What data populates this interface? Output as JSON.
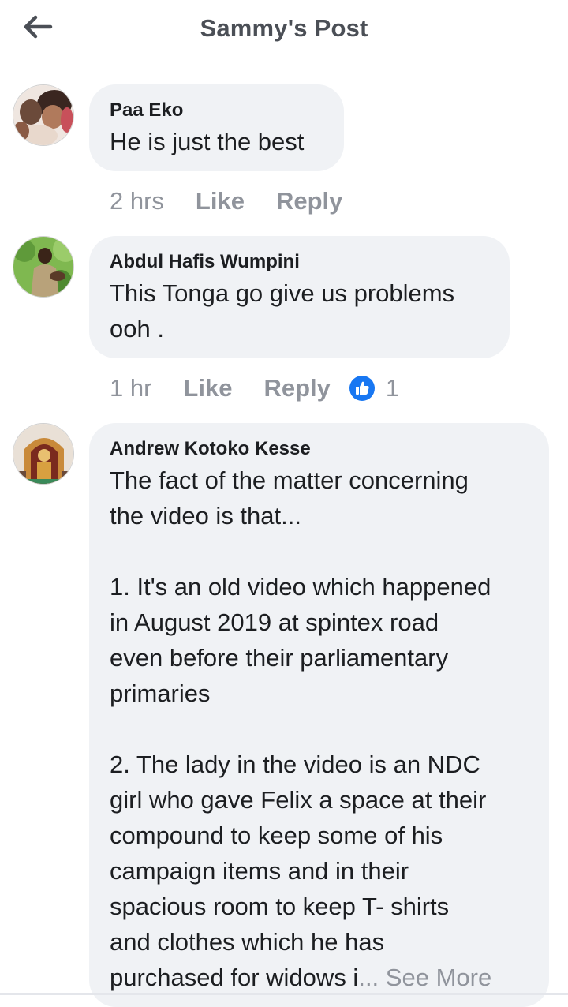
{
  "header": {
    "title": "Sammy's Post",
    "back_icon": "arrow-left-icon"
  },
  "colors": {
    "bubble": "#f0f2f5",
    "meta_text": "#90949c",
    "like_badge": "#1877f2",
    "title": "#4b4f56"
  },
  "comments": [
    {
      "author": "Paa Eko",
      "text": "He is just the best",
      "time": "2 hrs",
      "like_label": "Like",
      "reply_label": "Reply"
    },
    {
      "author": "Abdul Hafis Wumpini",
      "text": "This Tonga go give us problems\nooh .",
      "time": "1 hr",
      "like_label": "Like",
      "reply_label": "Reply",
      "reactions": "1"
    },
    {
      "author": "Andrew Kotoko Kesse",
      "text": "The fact of the matter concerning\nthe video is that...\n\n1. It's an old video which happened\nin August 2019 at spintex road\neven before their parliamentary\nprimaries\n\n2. The lady in the video is an NDC\ngirl who gave Felix a space at their\ncompound to keep some of his\ncampaign items and in their\nspacious room to keep T- shirts\nand clothes which he has\npurchased for widows i",
      "ellipsis": "...",
      "see_more": "See More"
    }
  ]
}
